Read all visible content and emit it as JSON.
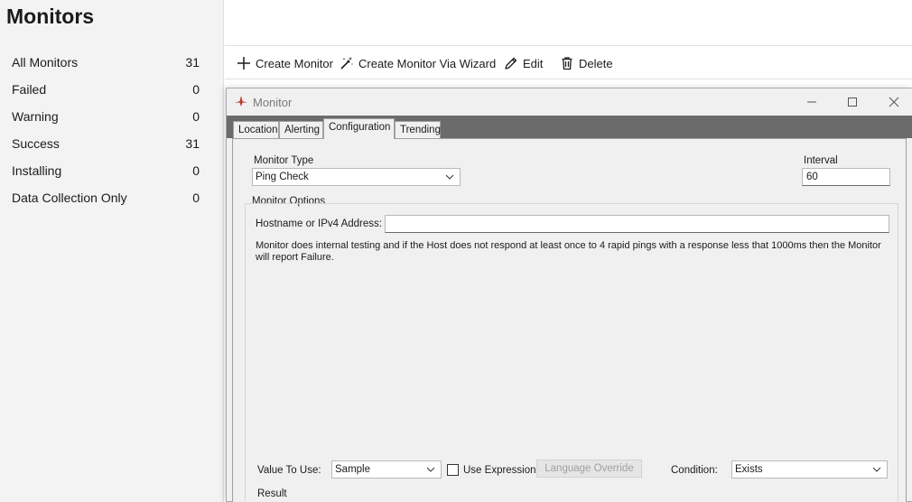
{
  "sidebar": {
    "title": "Monitors",
    "items": [
      {
        "label": "All Monitors",
        "count": "31"
      },
      {
        "label": "Failed",
        "count": "0"
      },
      {
        "label": "Warning",
        "count": "0"
      },
      {
        "label": "Success",
        "count": "31"
      },
      {
        "label": "Installing",
        "count": "0"
      },
      {
        "label": "Data Collection Only",
        "count": "0"
      }
    ]
  },
  "toolbar": {
    "create": "Create Monitor",
    "wizard": "Create Monitor Via Wizard",
    "edit": "Edit",
    "delete": "Delete"
  },
  "window": {
    "title": "Monitor",
    "tabs": [
      "Location",
      "Alerting",
      "Configuration",
      "Trending"
    ],
    "active_tab": "Configuration"
  },
  "config": {
    "monitor_type_label": "Monitor Type",
    "monitor_type_value": "Ping Check",
    "interval_label": "Interval",
    "interval_value": "60",
    "options_label": "Monitor Options",
    "hostname_label": "Hostname or IPv4 Address:",
    "hostname_value": "",
    "description": "Monitor does internal testing and if the Host does not respond at least once to 4 rapid pings with a response less that 1000ms then the Monitor will report Failure.",
    "value_to_use_label": "Value To Use:",
    "value_to_use_value": "Sample",
    "use_expression_label": "Use Expression",
    "language_override": "Language Override",
    "condition_label": "Condition:",
    "condition_value": "Exists",
    "result_label": "Result"
  },
  "colors": {
    "accent_icon": "#c0392b",
    "tab_strip": "#6b6b6b"
  }
}
